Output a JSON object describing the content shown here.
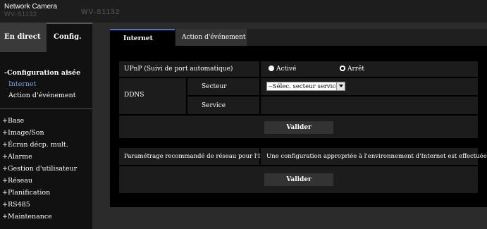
{
  "header": {
    "camera_label": "Network Camera",
    "camera_sub": "WV-S1132",
    "model": "WV-S1132"
  },
  "left_tabs": {
    "live": "En direct",
    "config": "Config."
  },
  "quick_setup": {
    "header": "-Configuration aisée",
    "items": [
      {
        "label": "Internet",
        "active": true
      },
      {
        "label": "Action d'événement",
        "active": false
      }
    ]
  },
  "menu": [
    "+Base",
    "+Image/Son",
    "+Écran décp. mult.",
    "+Alarme",
    "+Gestion d'utilisateur",
    "+Réseau",
    "+Planification",
    "+RS485",
    "+Maintenance"
  ],
  "main_tabs": [
    {
      "label": "Internet",
      "active": true
    },
    {
      "label": "Action d'événement",
      "active": false
    }
  ],
  "upnp": {
    "label": "UPnP (Suivi de port automatique)",
    "option_on": "Activé",
    "option_off": "Arrêt",
    "selected": "Arrêt"
  },
  "ddns": {
    "label": "DDNS",
    "sector_label": "Secteur",
    "sector_value": "--Sélec. secteur service--",
    "service_label": "Service"
  },
  "buttons": {
    "validate_1": "Valider",
    "validate_2": "Valider"
  },
  "recommended": {
    "label": "Paramétrage recommandé de réseau pour l'Internet",
    "description": "Une configuration appropriée à l'environnement d'Internet est effectuée."
  },
  "colors": {
    "active_blue": "#4a78c0",
    "link_blue": "#7aa6e8",
    "panel_bg": "#1c1c1c"
  }
}
